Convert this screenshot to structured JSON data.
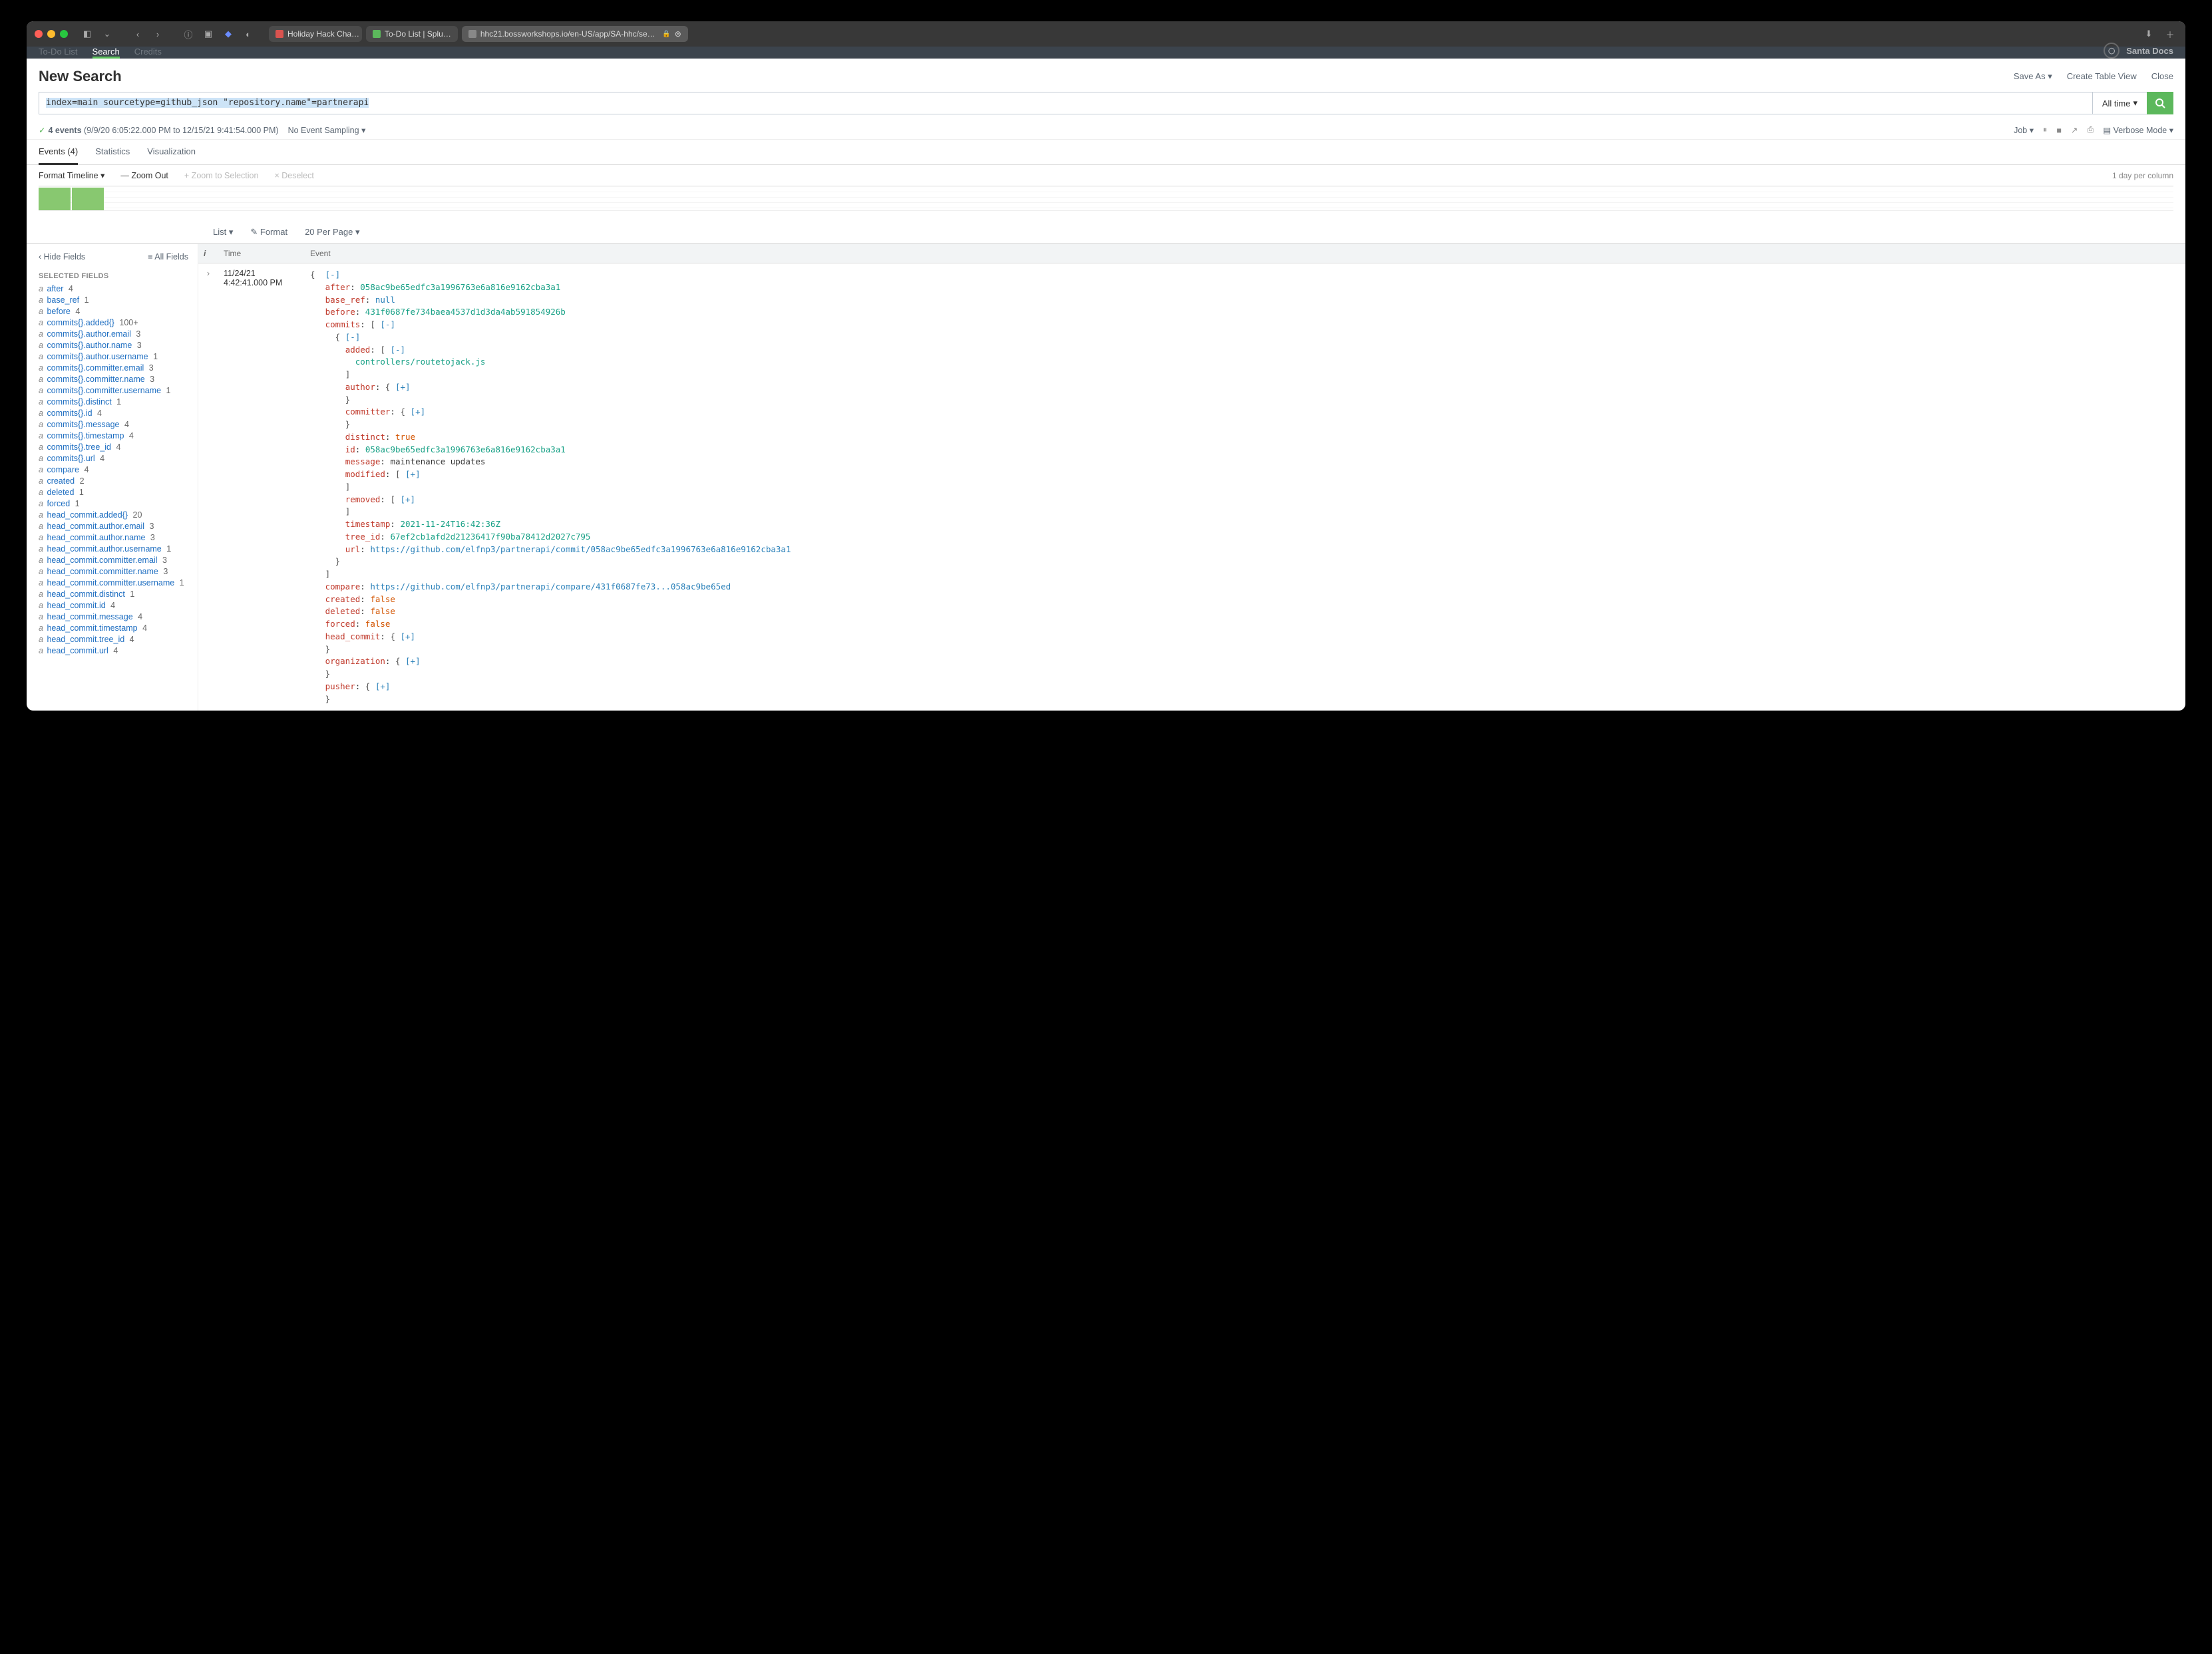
{
  "browser": {
    "tabs": [
      {
        "label": "Holiday Hack Cha…",
        "fav": "fav-red"
      },
      {
        "label": "To-Do List | Splu…",
        "fav": "fav-grn"
      }
    ],
    "url": "hhc21.bossworkshops.io/en-US/app/SA-hhc/search?q=search%2…"
  },
  "appnav": {
    "left": [
      "To-Do List",
      "Search",
      "Credits"
    ],
    "activeIndex": 1,
    "right": "Santa Docs"
  },
  "page": {
    "title": "New Search",
    "saveAs": "Save As",
    "createTable": "Create Table View",
    "close": "Close"
  },
  "search": {
    "query": "index=main sourcetype=github_json \"repository.name\"=partnerapi",
    "timeLabel": "All time"
  },
  "status": {
    "count": "4 events",
    "range": "(9/9/20 6:05:22.000 PM to 12/15/21 9:41:54.000 PM)",
    "sampling": "No Event Sampling",
    "job": "Job",
    "mode": "Verbose Mode"
  },
  "resultTabs": {
    "events": "Events (4)",
    "stats": "Statistics",
    "viz": "Visualization"
  },
  "tlControls": {
    "format": "Format Timeline",
    "zoomOut": "— Zoom Out",
    "zoomSel": "+ Zoom to Selection",
    "deselect": "× Deselect",
    "right": "1 day per column"
  },
  "viewRow": {
    "list": "List",
    "format": "Format",
    "perPage": "20 Per Page"
  },
  "sidebar": {
    "hide": "Hide Fields",
    "all": "All Fields",
    "selectedHead": "SELECTED FIELDS",
    "fields": [
      {
        "t": "a",
        "n": "after",
        "c": "4"
      },
      {
        "t": "a",
        "n": "base_ref",
        "c": "1"
      },
      {
        "t": "a",
        "n": "before",
        "c": "4"
      },
      {
        "t": "a",
        "n": "commits{}.added{}",
        "c": "100+"
      },
      {
        "t": "a",
        "n": "commits{}.author.email",
        "c": "3"
      },
      {
        "t": "a",
        "n": "commits{}.author.name",
        "c": "3"
      },
      {
        "t": "a",
        "n": "commits{}.author.username",
        "c": "1"
      },
      {
        "t": "a",
        "n": "commits{}.committer.email",
        "c": "3"
      },
      {
        "t": "a",
        "n": "commits{}.committer.name",
        "c": "3"
      },
      {
        "t": "a",
        "n": "commits{}.committer.username",
        "c": "1"
      },
      {
        "t": "a",
        "n": "commits{}.distinct",
        "c": "1"
      },
      {
        "t": "a",
        "n": "commits{}.id",
        "c": "4"
      },
      {
        "t": "a",
        "n": "commits{}.message",
        "c": "4"
      },
      {
        "t": "a",
        "n": "commits{}.timestamp",
        "c": "4"
      },
      {
        "t": "a",
        "n": "commits{}.tree_id",
        "c": "4"
      },
      {
        "t": "a",
        "n": "commits{}.url",
        "c": "4"
      },
      {
        "t": "a",
        "n": "compare",
        "c": "4"
      },
      {
        "t": "a",
        "n": "created",
        "c": "2"
      },
      {
        "t": "a",
        "n": "deleted",
        "c": "1"
      },
      {
        "t": "a",
        "n": "forced",
        "c": "1"
      },
      {
        "t": "a",
        "n": "head_commit.added{}",
        "c": "20"
      },
      {
        "t": "a",
        "n": "head_commit.author.email",
        "c": "3"
      },
      {
        "t": "a",
        "n": "head_commit.author.name",
        "c": "3"
      },
      {
        "t": "a",
        "n": "head_commit.author.username",
        "c": "1"
      },
      {
        "t": "a",
        "n": "head_commit.committer.email",
        "c": "3"
      },
      {
        "t": "a",
        "n": "head_commit.committer.name",
        "c": "3"
      },
      {
        "t": "a",
        "n": "head_commit.committer.username",
        "c": "1"
      },
      {
        "t": "a",
        "n": "head_commit.distinct",
        "c": "1"
      },
      {
        "t": "a",
        "n": "head_commit.id",
        "c": "4"
      },
      {
        "t": "a",
        "n": "head_commit.message",
        "c": "4"
      },
      {
        "t": "a",
        "n": "head_commit.timestamp",
        "c": "4"
      },
      {
        "t": "a",
        "n": "head_commit.tree_id",
        "c": "4"
      },
      {
        "t": "a",
        "n": "head_commit.url",
        "c": "4"
      }
    ]
  },
  "table": {
    "head": {
      "i": "i",
      "time": "Time",
      "event": "Event"
    },
    "row": {
      "date": "11/24/21",
      "time": "4:42:41.000 PM"
    }
  },
  "event": {
    "after": "058ac9be65edfc3a1996763e6a816e9162cba3a1",
    "base_ref": "null",
    "before": "431f0687fe734baea4537d1d3da4ab591854926b",
    "commit_added": "controllers/routetojack.js",
    "commit_distinct": "true",
    "commit_id": "058ac9be65edfc3a1996763e6a816e9162cba3a1",
    "commit_message": "maintenance updates",
    "commit_timestamp": "2021-11-24T16:42:36Z",
    "commit_tree_id": "67ef2cb1afd2d21236417f90ba78412d2027c795",
    "commit_url": "https://github.com/elfnp3/partnerapi/commit/058ac9be65edfc3a1996763e6a816e9162cba3a1",
    "compare": "https://github.com/elfnp3/partnerapi/compare/431f0687fe73...058ac9be65ed",
    "created": "false",
    "deleted": "false",
    "forced": "false"
  }
}
